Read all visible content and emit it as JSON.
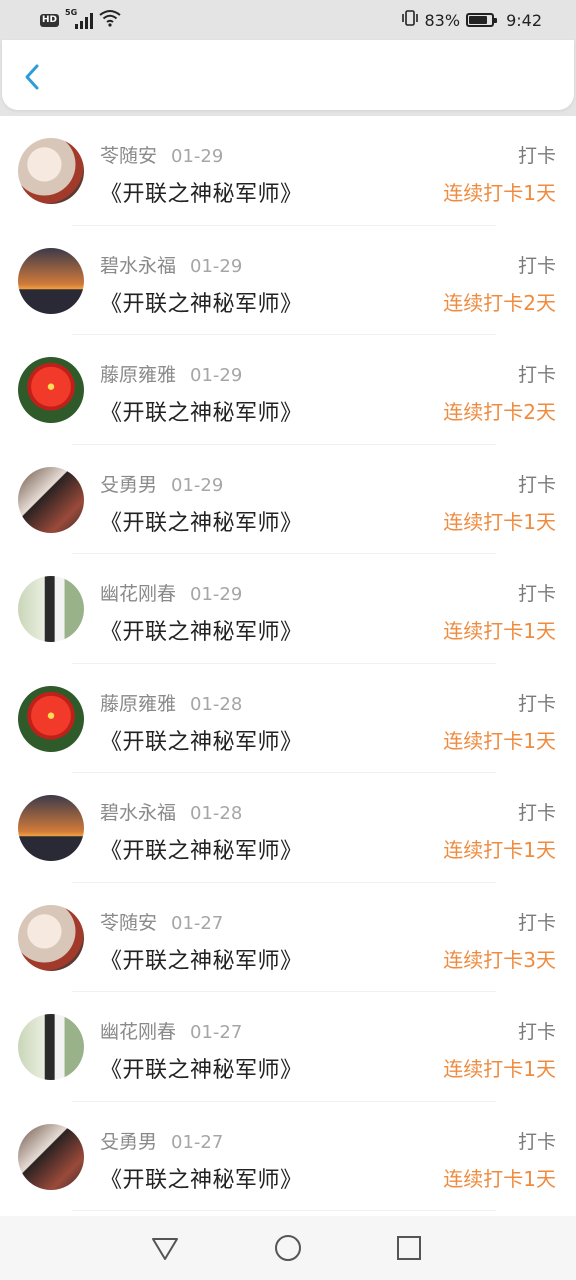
{
  "status_bar": {
    "network_badge": "HD",
    "network_gen": "5G",
    "battery_percent": "83%",
    "battery_level": 0.83,
    "time": "9:42"
  },
  "header": {
    "back_icon": "chevron-left-icon",
    "accent_color": "#2f9bd8"
  },
  "checkins": [
    {
      "user": "苓随安",
      "date": "01-29",
      "title": "《开联之神秘军师》",
      "type": "打卡",
      "streak": "连续打卡1天",
      "avatar": "girl"
    },
    {
      "user": "碧水永福",
      "date": "01-29",
      "title": "《开联之神秘军师》",
      "type": "打卡",
      "streak": "连续打卡2天",
      "avatar": "sunset"
    },
    {
      "user": "藤原雍雅",
      "date": "01-29",
      "title": "《开联之神秘军师》",
      "type": "打卡",
      "streak": "连续打卡2天",
      "avatar": "flower"
    },
    {
      "user": "殳勇男",
      "date": "01-29",
      "title": "《开联之神秘军师》",
      "type": "打卡",
      "streak": "连续打卡1天",
      "avatar": "dark"
    },
    {
      "user": "幽花刚春",
      "date": "01-29",
      "title": "《开联之神秘军师》",
      "type": "打卡",
      "streak": "连续打卡1天",
      "avatar": "woman"
    },
    {
      "user": "藤原雍雅",
      "date": "01-28",
      "title": "《开联之神秘军师》",
      "type": "打卡",
      "streak": "连续打卡1天",
      "avatar": "flower"
    },
    {
      "user": "碧水永福",
      "date": "01-28",
      "title": "《开联之神秘军师》",
      "type": "打卡",
      "streak": "连续打卡1天",
      "avatar": "sunset"
    },
    {
      "user": "苓随安",
      "date": "01-27",
      "title": "《开联之神秘军师》",
      "type": "打卡",
      "streak": "连续打卡3天",
      "avatar": "girl"
    },
    {
      "user": "幽花刚春",
      "date": "01-27",
      "title": "《开联之神秘军师》",
      "type": "打卡",
      "streak": "连续打卡1天",
      "avatar": "woman"
    },
    {
      "user": "殳勇男",
      "date": "01-27",
      "title": "《开联之神秘军师》",
      "type": "打卡",
      "streak": "连续打卡1天",
      "avatar": "dark"
    }
  ],
  "colors": {
    "streak": "#ef8b3f",
    "name": "#8a8a8a",
    "title": "#222222"
  },
  "nav_bar": {
    "back_icon": "triangle-back-icon",
    "home_icon": "circle-home-icon",
    "recents_icon": "square-recents-icon"
  }
}
